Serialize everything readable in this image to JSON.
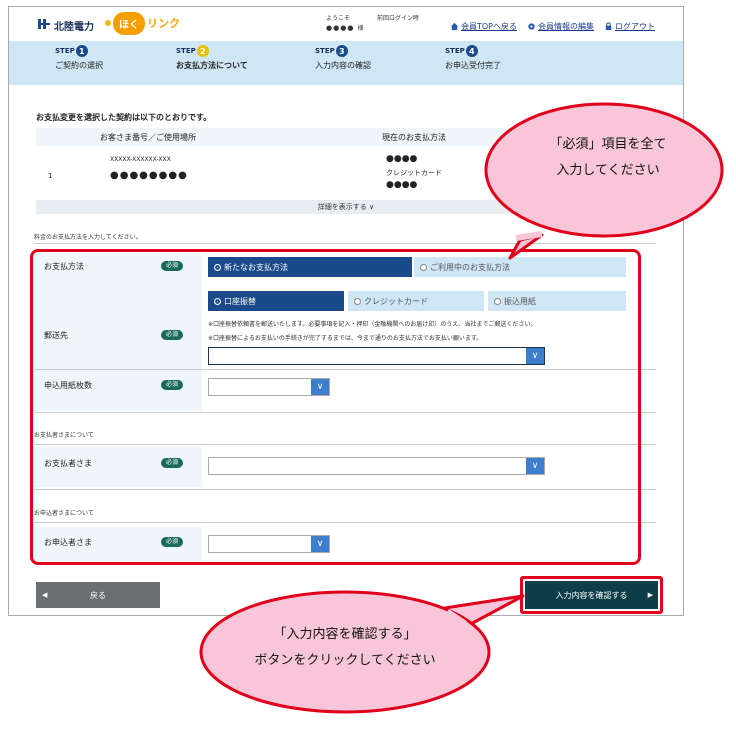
{
  "header": {
    "company": "北陸電力",
    "service_hoku": "ほく",
    "service_link": "リンク",
    "welcome": "ようこそ",
    "user_name": "●●●●",
    "honorific": "様",
    "last_login": "前回ログイン時",
    "nav": [
      "会員TOPへ戻る",
      "会員情報の編集",
      "ログアウト"
    ]
  },
  "steps": [
    {
      "step": "STEP",
      "num": "1",
      "label": "ご契約の選択"
    },
    {
      "step": "STEP",
      "num": "2",
      "label": "お支払方法について"
    },
    {
      "step": "STEP",
      "num": "3",
      "label": "入力内容の確認"
    },
    {
      "step": "STEP",
      "num": "4",
      "label": "お申込受付完了"
    }
  ],
  "contract": {
    "intro": "お支払変更を選択した契約は以下のとおりです。",
    "col1": "お客さま番号／ご使用場所",
    "col2": "現在のお支払方法",
    "row_no": "1",
    "customer_no": "XXXXX-XXXXXX-XXX",
    "place": "●●●●●●●●",
    "pay_dots1": "●●●●",
    "pay_method": "クレジットカード",
    "pay_dots2": "●●●●",
    "detail": "詳細を表示する ∨"
  },
  "form": {
    "prompt": "料金のお支払方法を入力してください。",
    "required": "必須",
    "payment_label": "お支払方法",
    "tab_new": "新たなお支払方法",
    "tab_current": "ご利用中のお支払方法",
    "sub_account": "口座振替",
    "sub_credit": "クレジットカード",
    "sub_slip": "振込用紙",
    "note1": "※口座振替依頼書を郵送いたします。必要事項を記入・押印（金融機関へのお届け印）のうえ、当社までご郵送ください。",
    "note2": "※口座振替によるお支払いの手続きが完了するまでは、今まで通りのお支払方法でお支払い願います。",
    "mail_label": "郵送先",
    "sheets_label": "申込用紙枚数",
    "payer_section": "お支払者さまについて",
    "payer_label": "お支払者さま",
    "applicant_section": "お申込者さまについて",
    "applicant_label": "お申込者さま"
  },
  "buttons": {
    "back": "戻る",
    "confirm": "入力内容を確認する"
  },
  "callouts": {
    "top_line1": "「必須」項目を全て",
    "top_line2": "入力してください",
    "bottom_line1": "「入力内容を確認する」",
    "bottom_line2": "ボタンをクリックしてください"
  },
  "colors": {
    "accent": "#1a4a8a",
    "highlight": "#e0001b",
    "bubble": "#f8c6d8",
    "confirm": "#0d3e4a"
  }
}
